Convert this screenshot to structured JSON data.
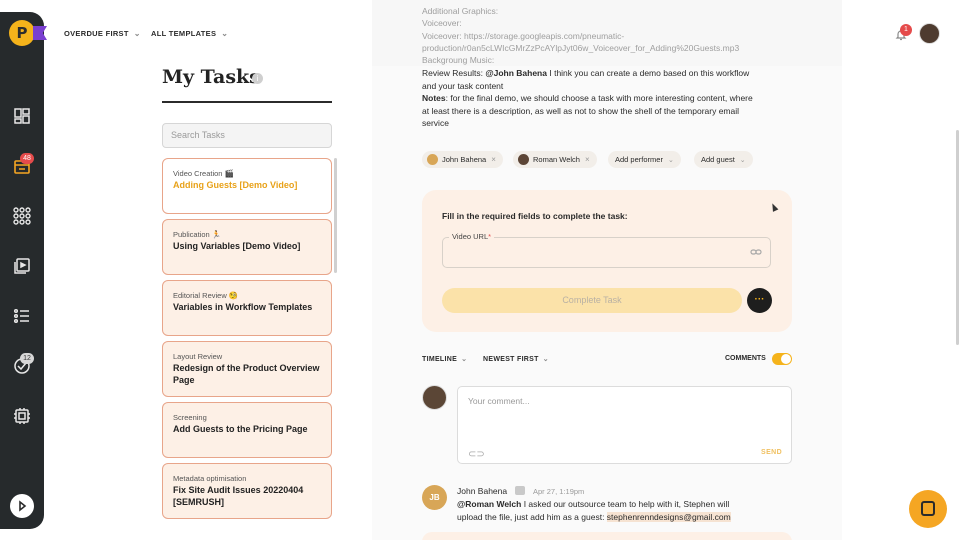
{
  "filters": {
    "overdue": "OVERDUE FIRST",
    "templates": "ALL TEMPLATES"
  },
  "rail": {
    "tasks_badge": "48",
    "highlights_badge": "12"
  },
  "tasklist": {
    "title": "My Tasks",
    "info": "i",
    "search_placeholder": "Search Tasks",
    "cards": [
      {
        "category": "Video Creation 🎬",
        "name": "Adding Guests [Demo Video]"
      },
      {
        "category": "Publication 🏃",
        "name": "Using Variables [Demo Video]"
      },
      {
        "category": "Editorial Review 🧐",
        "name": "Variables in Workflow Templates"
      },
      {
        "category": "Layout Review",
        "name": "Redesign of the Product Overview Page"
      },
      {
        "category": "Screening",
        "name": "Add Guests to the Pricing Page"
      },
      {
        "category": "Metadata optimisation",
        "name": "Fix Site Audit Issues 20220404 [SEMRUSH]"
      }
    ]
  },
  "task": {
    "meta": {
      "additional_graphics": "Additional Graphics:",
      "voiceover": "Voiceover:",
      "voiceover_url_1": "Voiceover: https://storage.googleapis.com/pneumatic-",
      "voiceover_url_2": "production/r0an5cLWIcGMrZzPcAYlpJyt06w_Voiceover_for_Adding%20Guests.mp3",
      "background_music": "Backgroung Music:"
    },
    "review_label": "Review Results:",
    "review_mention": "@John Bahena",
    "review_text_1": "I think you can create a demo based on this workflow",
    "review_text_2": "and your task content",
    "notes_label": "Notes",
    "notes_text_1": ": for the final demo, we should choose a task with more interesting content, where",
    "notes_text_2": "at least there is a description, as well as not to show the shell of the temporary email",
    "notes_text_3": "service",
    "performers": [
      "John Bahena",
      "Roman Welch"
    ],
    "add_performer": "Add performer",
    "add_guest": "Add guest",
    "form_title": "Fill in the required fields to complete the task:",
    "field_label": "Video URL",
    "field_required": "*",
    "complete_label": "Complete Task",
    "more_label": "···"
  },
  "timeline": {
    "filter": "TIMELINE",
    "order": "NEWEST FIRST",
    "comments_label": "COMMENTS",
    "comments_on": true,
    "comment_placeholder": "Your comment...",
    "send_label": "SEND",
    "comment": {
      "initials": "JB",
      "author": "John Bahena",
      "date": "Apr 27, 1:19pm",
      "mention": "@Roman Welch",
      "text_1": " I asked our outsource team to help with it, Stephen will",
      "text_2": "upload the file, just add him as a guest: ",
      "email": "stephenrenndesigns@gmail.com"
    }
  },
  "header": {
    "notifications": "1"
  },
  "colors": {
    "accent": "#f5b31b",
    "rail": "#262a2c",
    "card_bg": "#fdf0e6",
    "badge": "#e54b4b"
  }
}
